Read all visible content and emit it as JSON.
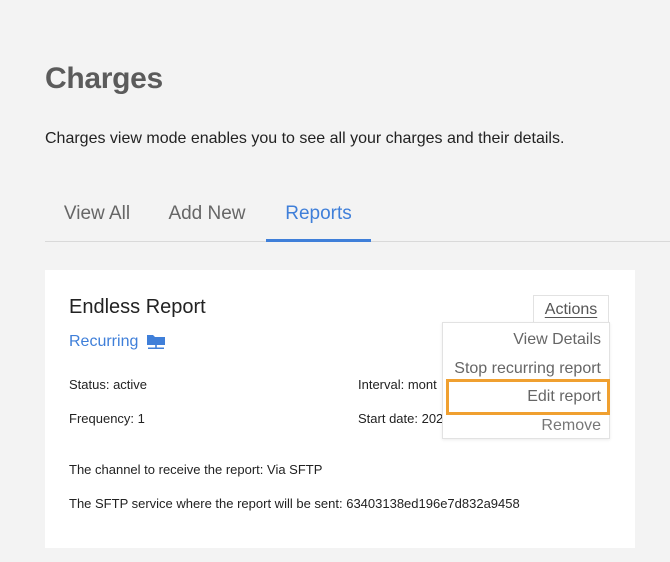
{
  "page": {
    "title": "Charges",
    "description": "Charges view mode enables you to see all your charges and their details."
  },
  "tabs": [
    {
      "label": "View All",
      "active": false
    },
    {
      "label": "Add New",
      "active": false
    },
    {
      "label": "Reports",
      "active": true
    }
  ],
  "report": {
    "title": "Endless Report",
    "type_label": "Recurring",
    "type_icon": "folder-network-icon",
    "status": "Status: active",
    "interval": "Interval: mont",
    "frequency": "Frequency: 1",
    "start_date": "Start date: 202",
    "channel": "The channel to receive the report: Via SFTP",
    "sftp_service": "The SFTP service where the report will be sent: 63403138ed196e7d832a9458"
  },
  "actions": {
    "button_label": "Actions",
    "menu": [
      {
        "label": "View Details"
      },
      {
        "label": "Stop recurring report"
      },
      {
        "label": "Edit report",
        "highlighted": true
      },
      {
        "label": "Remove"
      }
    ]
  },
  "colors": {
    "accent": "#3f7fd9",
    "highlight": "#f0a030",
    "background": "#f3f3f3"
  }
}
